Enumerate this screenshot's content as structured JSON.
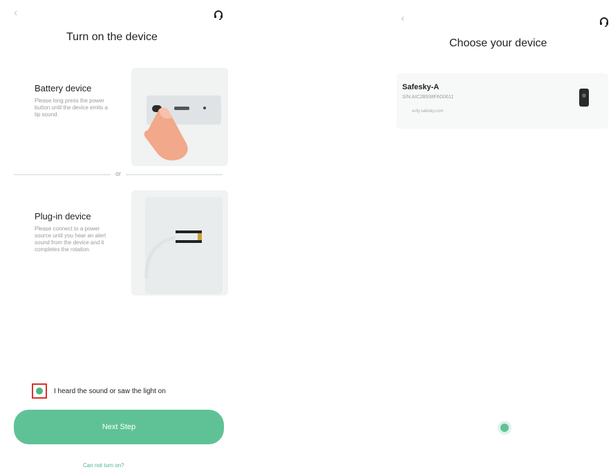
{
  "left": {
    "back_icon": "‹",
    "support_icon": "headset-icon",
    "title": "Turn on the device",
    "battery": {
      "title": "Battery device",
      "description": "Please long press the power button until the device emits a tip sound."
    },
    "or_label": "or",
    "plugin": {
      "title": "Plug-in device",
      "description": "Please connect to a power source until you hear an alert sound from the device and it completes the rotation."
    },
    "checkbox_label": "I heard the sound or saw the light on",
    "next_button": "Next Step",
    "cannot_turn_on": "Can not turn on?"
  },
  "right": {
    "back_icon": "‹",
    "support_icon": "headset-icon",
    "title": "Choose your device",
    "device": {
      "name": "Safesky-A",
      "sn": "S/N:AIC2B938F6G0611",
      "meta": "eufy.safesky.com"
    }
  },
  "colors": {
    "accent": "#5fc296",
    "check_outline": "#d6322a"
  }
}
